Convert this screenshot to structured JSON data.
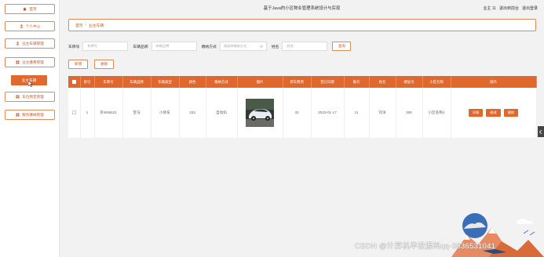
{
  "header": {
    "title": "基于Java的小区物业管理系统设计与实现",
    "user_label": "业主 11",
    "back_label": "退出到前台",
    "logout_label": "退出登录"
  },
  "sidebar": {
    "items": [
      {
        "label": "首页",
        "icon": "home-icon"
      },
      {
        "label": "个人中心",
        "icon": "user-icon"
      },
      {
        "label": "业主车辆管理",
        "icon": "user-icon"
      },
      {
        "label": "业主缴费管理",
        "icon": "grid-icon"
      },
      {
        "label": "车位预定管理",
        "icon": "grid-icon"
      },
      {
        "label": "服务缴纳管理",
        "icon": "grid-icon"
      }
    ],
    "submenu": {
      "label": "业主车辆"
    }
  },
  "breadcrumb": {
    "home": "首页",
    "separator": "/",
    "current": "业主车辆"
  },
  "search": {
    "plate_label": "车牌号",
    "plate_placeholder": "车牌号",
    "brand_label": "车辆品牌",
    "brand_placeholder": "车辆品牌",
    "method_label": "缴纳方式",
    "method_placeholder": "请选择缴纳方式",
    "name_label": "姓名",
    "name_placeholder": "姓名",
    "button": "查询"
  },
  "actions": {
    "add": "新增",
    "delete": "删除"
  },
  "table": {
    "columns": [
      "",
      "索引",
      "车牌号",
      "车辆品牌",
      "车辆类型",
      "颜色",
      "缴纳方式",
      "图片",
      "停车费用",
      "登记日期",
      "账号",
      "姓名",
      "楼层号",
      "小区名称",
      "操作"
    ],
    "rows": [
      {
        "index": "1",
        "plate": "京W55521",
        "brand": "宝马",
        "type": "小轿车",
        "color": "333",
        "method": "自动扣",
        "fee": "33",
        "date": "2023-01-17",
        "account": "11",
        "name": "刘洋",
        "floor": "305",
        "community": "小区名称4"
      }
    ],
    "ops": {
      "detail": "详情",
      "edit": "修改",
      "delete": "删除"
    }
  },
  "watermark": "CSDN @计算机毕设源码qq-3836531041",
  "colors": {
    "accent": "#e0682d",
    "border": "#e08a5a",
    "text_accent": "#c25a2a"
  }
}
